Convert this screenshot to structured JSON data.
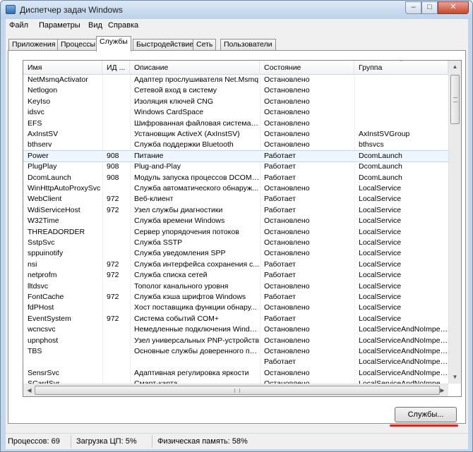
{
  "window": {
    "title": "Диспетчер задач Windows",
    "controls": {
      "minimize": "–",
      "maximize": "□",
      "close": "✕"
    }
  },
  "menu": [
    "Файл",
    "Параметры",
    "Вид",
    "Справка"
  ],
  "tabs": [
    "Приложения",
    "Процессы",
    "Службы",
    "Быстродействие",
    "Сеть",
    "Пользователи"
  ],
  "active_tab": "Службы",
  "columns": {
    "name": "Имя",
    "pid": "ИД ...",
    "description": "Описание",
    "state": "Состояние",
    "group": "Группа"
  },
  "rows": [
    {
      "name": "NetMsmqActivator",
      "pid": "",
      "description": "Адаптер прослушивателя Net.Msmq",
      "state": "Остановлено",
      "group": ""
    },
    {
      "name": "Netlogon",
      "pid": "",
      "description": "Сетевой вход в систему",
      "state": "Остановлено",
      "group": ""
    },
    {
      "name": "KeyIso",
      "pid": "",
      "description": "Изоляция ключей CNG",
      "state": "Остановлено",
      "group": ""
    },
    {
      "name": "idsvc",
      "pid": "",
      "description": "Windows CardSpace",
      "state": "Остановлено",
      "group": ""
    },
    {
      "name": "EFS",
      "pid": "",
      "description": "Шифрованная файловая система (...",
      "state": "Остановлено",
      "group": ""
    },
    {
      "name": "AxInstSV",
      "pid": "",
      "description": "Установщик ActiveX (AxInstSV)",
      "state": "Остановлено",
      "group": "AxInstSVGroup"
    },
    {
      "name": "bthserv",
      "pid": "",
      "description": "Служба поддержки Bluetooth",
      "state": "Остановлено",
      "group": "bthsvcs"
    },
    {
      "name": "Power",
      "pid": "908",
      "description": "Питание",
      "state": "Работает",
      "group": "DcomLaunch"
    },
    {
      "name": "PlugPlay",
      "pid": "908",
      "description": "Plug-and-Play",
      "state": "Работает",
      "group": "DcomLaunch"
    },
    {
      "name": "DcomLaunch",
      "pid": "908",
      "description": "Модуль запуска процессов DCOM-...",
      "state": "Работает",
      "group": "DcomLaunch"
    },
    {
      "name": "WinHttpAutoProxySvc",
      "pid": "",
      "description": "Служба автоматического обнаруж...",
      "state": "Остановлено",
      "group": "LocalService"
    },
    {
      "name": "WebClient",
      "pid": "972",
      "description": "Веб-клиент",
      "state": "Работает",
      "group": "LocalService"
    },
    {
      "name": "WdiServiceHost",
      "pid": "972",
      "description": "Узел службы диагностики",
      "state": "Работает",
      "group": "LocalService"
    },
    {
      "name": "W32Time",
      "pid": "",
      "description": "Служба времени Windows",
      "state": "Остановлено",
      "group": "LocalService"
    },
    {
      "name": "THREADORDER",
      "pid": "",
      "description": "Сервер упорядочения потоков",
      "state": "Остановлено",
      "group": "LocalService"
    },
    {
      "name": "SstpSvc",
      "pid": "",
      "description": "Служба SSTP",
      "state": "Остановлено",
      "group": "LocalService"
    },
    {
      "name": "sppuinotify",
      "pid": "",
      "description": "Служба уведомления SPP",
      "state": "Остановлено",
      "group": "LocalService"
    },
    {
      "name": "nsi",
      "pid": "972",
      "description": "Служба интерфейса сохранения с...",
      "state": "Работает",
      "group": "LocalService"
    },
    {
      "name": "netprofm",
      "pid": "972",
      "description": "Служба списка сетей",
      "state": "Работает",
      "group": "LocalService"
    },
    {
      "name": "lltdsvc",
      "pid": "",
      "description": "Тополог канального уровня",
      "state": "Остановлено",
      "group": "LocalService"
    },
    {
      "name": "FontCache",
      "pid": "972",
      "description": "Служба кэша шрифтов Windows",
      "state": "Работает",
      "group": "LocalService"
    },
    {
      "name": "fdPHost",
      "pid": "",
      "description": "Хост поставщика функции обнару...",
      "state": "Остановлено",
      "group": "LocalService"
    },
    {
      "name": "EventSystem",
      "pid": "972",
      "description": "Система событий COM+",
      "state": "Работает",
      "group": "LocalService"
    },
    {
      "name": "wcncsvc",
      "pid": "",
      "description": "Немедленные подключения Windo...",
      "state": "Остановлено",
      "group": "LocalServiceAndNoImper..."
    },
    {
      "name": "upnphost",
      "pid": "",
      "description": "Узел универсальных PNP-устройств",
      "state": "Остановлено",
      "group": "LocalServiceAndNoImper..."
    },
    {
      "name": "TBS",
      "pid": "",
      "description": "Основные службы доверенного пл...",
      "state": "Остановлено",
      "group": "LocalServiceAndNoImper..."
    },
    {
      "name": "",
      "pid": "",
      "description": "",
      "state": "Работает",
      "group": "LocalServiceAndNoImper..."
    },
    {
      "name": "SensrSvc",
      "pid": "",
      "description": "Адаптивная регулировка яркости",
      "state": "Остановлено",
      "group": "LocalServiceAndNoImper..."
    },
    {
      "name": "SCardSvr",
      "pid": "",
      "description": "Смарт-карта",
      "state": "Остановлено",
      "group": "LocalServiceAndNoImper..."
    }
  ],
  "selected_row": "Power",
  "buttons": {
    "services": "Службы..."
  },
  "status": {
    "processes": "Процессов: 69",
    "cpu": "Загрузка ЦП: 5%",
    "memory": "Физическая память: 58%"
  },
  "icons": {
    "scroll_up": "▲",
    "scroll_down": "▼",
    "scroll_left": "◀",
    "scroll_right": "▶",
    "sort_indicator": "^"
  },
  "colors": {
    "highlight_underline": "#e0241b",
    "selection": "#eef5fd"
  }
}
